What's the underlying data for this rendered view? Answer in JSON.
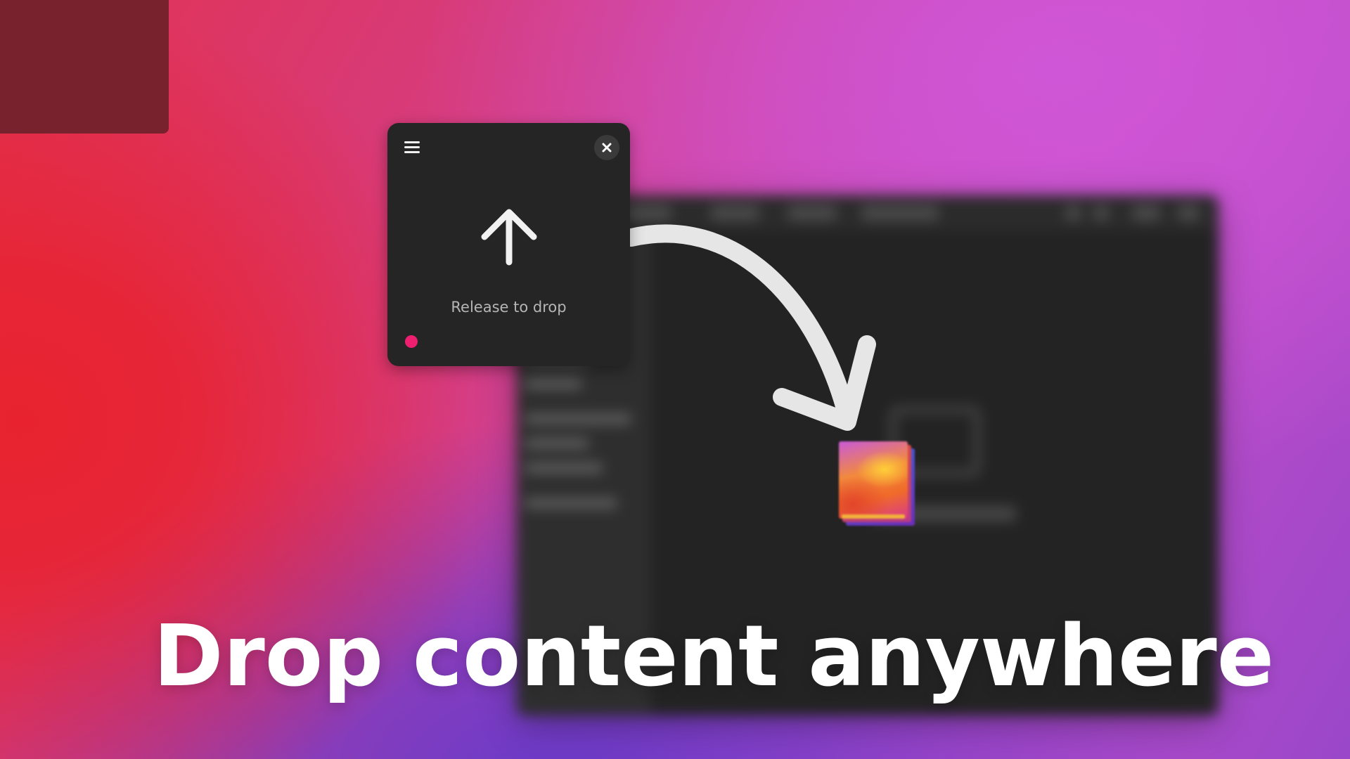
{
  "drop_widget": {
    "status_text": "Release to drop",
    "menu_icon": "hamburger-menu-icon",
    "close_icon": "close-icon",
    "arrow_icon": "arrow-up-icon",
    "status_dot_color": "#ee1f6f"
  },
  "drag_item": {
    "icon": "image-file-stack-icon"
  },
  "background_window": {
    "icon": "folder-icon"
  },
  "caption": {
    "text": "Drop content anywhere"
  },
  "colors": {
    "widget_background": "#252525",
    "accent_dot": "#ee1f6f",
    "caption_text": "#ffffff"
  }
}
